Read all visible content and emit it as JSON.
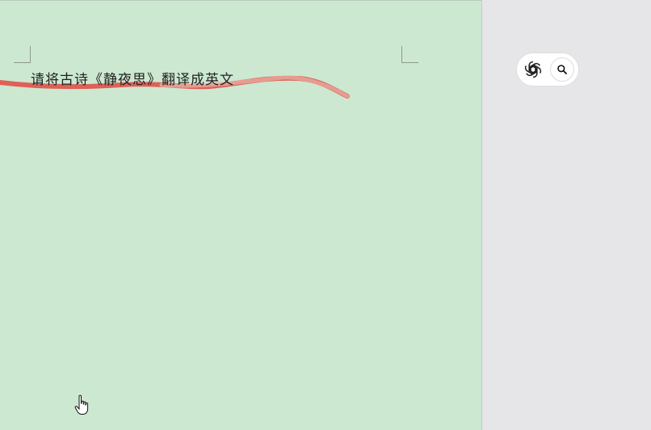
{
  "document": {
    "text": "请将古诗《静夜思》翻译成英文",
    "background_color": "#cce8d1"
  },
  "annotation": {
    "stroke_color": "#e0524a"
  },
  "assistant": {
    "logo_icon": "openai-logo-icon",
    "search_icon": "search-icon"
  },
  "cursor": {
    "icon": "hand-pointer-icon"
  }
}
